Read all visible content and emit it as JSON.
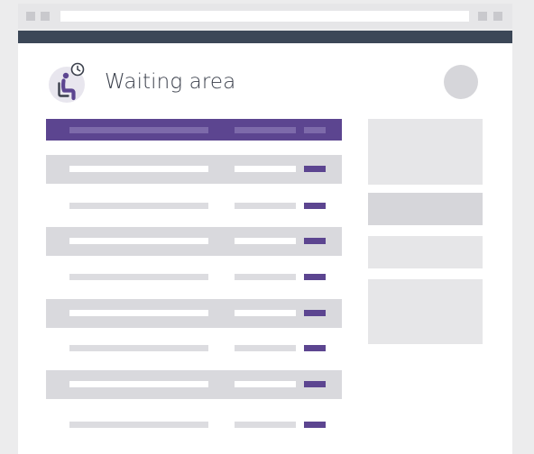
{
  "header": {
    "title": "Waiting area",
    "icon": "waiting-room-icon",
    "accent_color": "#5c4590"
  },
  "table": {
    "header_color": "#5c4590",
    "rows": [
      {
        "style": "shaded"
      },
      {
        "style": "plain"
      },
      {
        "style": "shaded"
      },
      {
        "style": "plain"
      },
      {
        "style": "shaded"
      },
      {
        "style": "plain"
      },
      {
        "style": "shaded"
      },
      {
        "style": "plain"
      }
    ]
  },
  "sidebar": {
    "panels": 4
  }
}
